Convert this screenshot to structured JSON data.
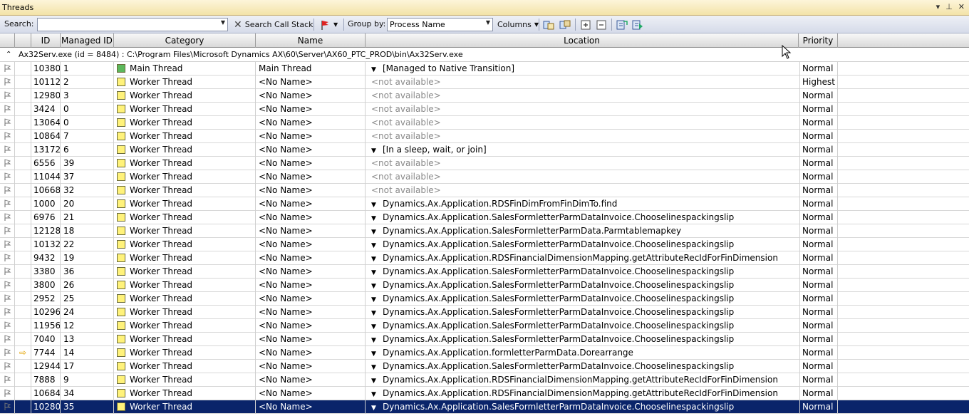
{
  "window": {
    "title": "Threads"
  },
  "toolbar": {
    "search_label": "Search:",
    "search_value": "",
    "search_call_stack": "Search Call Stack",
    "group_by_label": "Group by:",
    "group_by_value": "Process Name",
    "columns_label": "Columns"
  },
  "headers": {
    "id": "ID",
    "managed_id": "Managed ID",
    "category": "Category",
    "name": "Name",
    "location": "Location",
    "priority": "Priority"
  },
  "group_header": "Ax32Serv.exe (id = 8484) : C:\\Program Files\\Microsoft Dynamics AX\\60\\Server\\AX60_PTC_PROD\\bin\\Ax32Serv.exe",
  "colors": {
    "main_thread": "#5cb85c",
    "worker_thread": "#fff27a",
    "selection": "#0a246a"
  },
  "rows": [
    {
      "id": "10380",
      "managed_id": "1",
      "category": "Main Thread",
      "name": "Main Thread",
      "location": "[Managed to Native Transition]",
      "loc_available": true,
      "priority": "Normal"
    },
    {
      "id": "10112",
      "managed_id": "2",
      "category": "Worker Thread",
      "name": "<No Name>",
      "location": "<not available>",
      "loc_available": false,
      "priority": "Highest"
    },
    {
      "id": "12980",
      "managed_id": "3",
      "category": "Worker Thread",
      "name": "<No Name>",
      "location": "<not available>",
      "loc_available": false,
      "priority": "Normal"
    },
    {
      "id": "3424",
      "managed_id": "0",
      "category": "Worker Thread",
      "name": "<No Name>",
      "location": "<not available>",
      "loc_available": false,
      "priority": "Normal"
    },
    {
      "id": "13064",
      "managed_id": "0",
      "category": "Worker Thread",
      "name": "<No Name>",
      "location": "<not available>",
      "loc_available": false,
      "priority": "Normal"
    },
    {
      "id": "10864",
      "managed_id": "7",
      "category": "Worker Thread",
      "name": "<No Name>",
      "location": "<not available>",
      "loc_available": false,
      "priority": "Normal"
    },
    {
      "id": "13172",
      "managed_id": "6",
      "category": "Worker Thread",
      "name": "<No Name>",
      "location": "[In a sleep, wait, or join]",
      "loc_available": true,
      "priority": "Normal"
    },
    {
      "id": "6556",
      "managed_id": "39",
      "category": "Worker Thread",
      "name": "<No Name>",
      "location": "<not available>",
      "loc_available": false,
      "priority": "Normal"
    },
    {
      "id": "11044",
      "managed_id": "37",
      "category": "Worker Thread",
      "name": "<No Name>",
      "location": "<not available>",
      "loc_available": false,
      "priority": "Normal"
    },
    {
      "id": "10668",
      "managed_id": "32",
      "category": "Worker Thread",
      "name": "<No Name>",
      "location": "<not available>",
      "loc_available": false,
      "priority": "Normal"
    },
    {
      "id": "1000",
      "managed_id": "20",
      "category": "Worker Thread",
      "name": "<No Name>",
      "location": "Dynamics.Ax.Application.RDSFinDimFromFinDimTo.find",
      "loc_available": true,
      "priority": "Normal"
    },
    {
      "id": "6976",
      "managed_id": "21",
      "category": "Worker Thread",
      "name": "<No Name>",
      "location": "Dynamics.Ax.Application.SalesFormletterParmDataInvoice.Chooselinespackingslip",
      "loc_available": true,
      "priority": "Normal"
    },
    {
      "id": "12128",
      "managed_id": "18",
      "category": "Worker Thread",
      "name": "<No Name>",
      "location": "Dynamics.Ax.Application.SalesFormletterParmData.Parmtablemapkey",
      "loc_available": true,
      "priority": "Normal"
    },
    {
      "id": "10132",
      "managed_id": "22",
      "category": "Worker Thread",
      "name": "<No Name>",
      "location": "Dynamics.Ax.Application.SalesFormletterParmDataInvoice.Chooselinespackingslip",
      "loc_available": true,
      "priority": "Normal"
    },
    {
      "id": "9432",
      "managed_id": "19",
      "category": "Worker Thread",
      "name": "<No Name>",
      "location": "Dynamics.Ax.Application.RDSFinancialDimensionMapping.getAttributeRecIdForFinDimension",
      "loc_available": true,
      "priority": "Normal"
    },
    {
      "id": "3380",
      "managed_id": "36",
      "category": "Worker Thread",
      "name": "<No Name>",
      "location": "Dynamics.Ax.Application.SalesFormletterParmDataInvoice.Chooselinespackingslip",
      "loc_available": true,
      "priority": "Normal"
    },
    {
      "id": "3800",
      "managed_id": "26",
      "category": "Worker Thread",
      "name": "<No Name>",
      "location": "Dynamics.Ax.Application.SalesFormletterParmDataInvoice.Chooselinespackingslip",
      "loc_available": true,
      "priority": "Normal"
    },
    {
      "id": "2952",
      "managed_id": "25",
      "category": "Worker Thread",
      "name": "<No Name>",
      "location": "Dynamics.Ax.Application.SalesFormletterParmDataInvoice.Chooselinespackingslip",
      "loc_available": true,
      "priority": "Normal"
    },
    {
      "id": "10296",
      "managed_id": "24",
      "category": "Worker Thread",
      "name": "<No Name>",
      "location": "Dynamics.Ax.Application.SalesFormletterParmDataInvoice.Chooselinespackingslip",
      "loc_available": true,
      "priority": "Normal"
    },
    {
      "id": "11956",
      "managed_id": "12",
      "category": "Worker Thread",
      "name": "<No Name>",
      "location": "Dynamics.Ax.Application.SalesFormletterParmDataInvoice.Chooselinespackingslip",
      "loc_available": true,
      "priority": "Normal"
    },
    {
      "id": "7040",
      "managed_id": "13",
      "category": "Worker Thread",
      "name": "<No Name>",
      "location": "Dynamics.Ax.Application.SalesFormletterParmDataInvoice.Chooselinespackingslip",
      "loc_available": true,
      "priority": "Normal"
    },
    {
      "id": "7744",
      "managed_id": "14",
      "category": "Worker Thread",
      "name": "<No Name>",
      "location": "Dynamics.Ax.Application.formletterParmData.Dorearrange",
      "loc_available": true,
      "priority": "Normal",
      "current": true
    },
    {
      "id": "12944",
      "managed_id": "17",
      "category": "Worker Thread",
      "name": "<No Name>",
      "location": "Dynamics.Ax.Application.SalesFormletterParmDataInvoice.Chooselinespackingslip",
      "loc_available": true,
      "priority": "Normal"
    },
    {
      "id": "7888",
      "managed_id": "9",
      "category": "Worker Thread",
      "name": "<No Name>",
      "location": "Dynamics.Ax.Application.RDSFinancialDimensionMapping.getAttributeRecIdForFinDimension",
      "loc_available": true,
      "priority": "Normal"
    },
    {
      "id": "10684",
      "managed_id": "34",
      "category": "Worker Thread",
      "name": "<No Name>",
      "location": "Dynamics.Ax.Application.RDSFinancialDimensionMapping.getAttributeRecIdForFinDimension",
      "loc_available": true,
      "priority": "Normal"
    },
    {
      "id": "10280",
      "managed_id": "35",
      "category": "Worker Thread",
      "name": "<No Name>",
      "location": "Dynamics.Ax.Application.SalesFormletterParmDataInvoice.Chooselinespackingslip",
      "loc_available": true,
      "priority": "Normal",
      "selected": true
    }
  ]
}
